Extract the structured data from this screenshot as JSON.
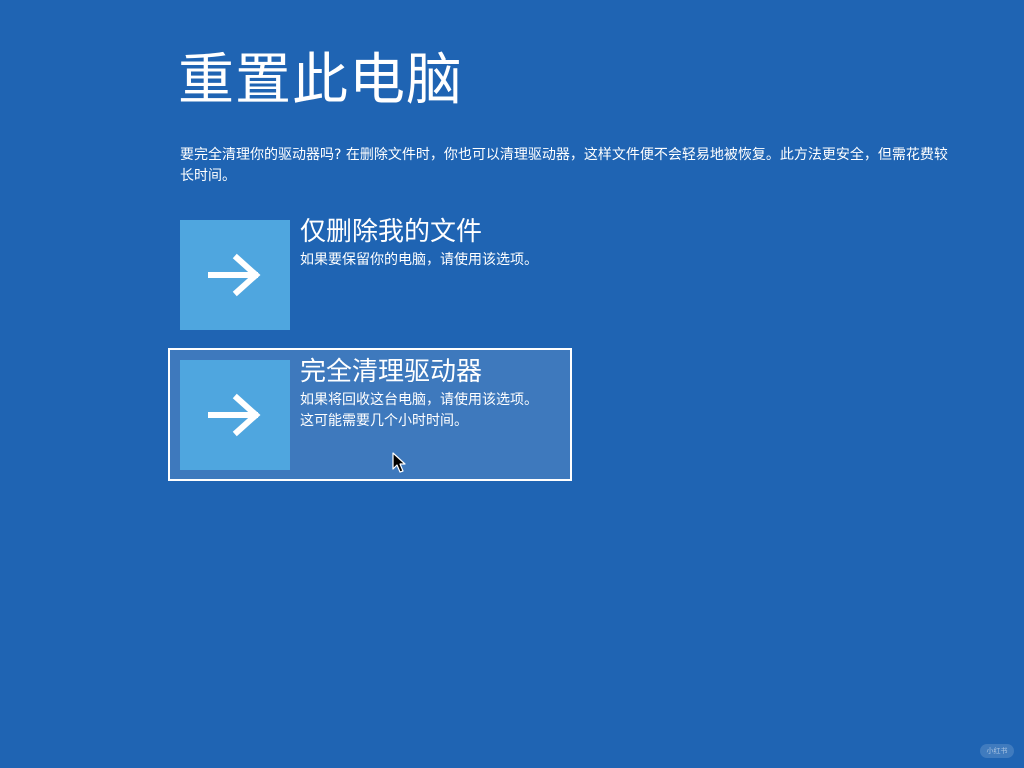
{
  "page": {
    "title": "重置此电脑",
    "description": "要完全清理你的驱动器吗? 在删除文件时，你也可以清理驱动器，这样文件便不会轻易地被恢复。此方法更安全，但需花费较长时间。"
  },
  "options": [
    {
      "title": "仅删除我的文件",
      "description": "如果要保留你的电脑，请使用该选项。",
      "icon": "arrow-right-icon",
      "selected": false
    },
    {
      "title": "完全清理驱动器",
      "description": "如果将回收这台电脑，请使用该选项。这可能需要几个小时时间。",
      "icon": "arrow-right-icon",
      "selected": true
    }
  ],
  "colors": {
    "background": "#1f64b3",
    "tile": "#4fa6df",
    "text": "#ffffff"
  },
  "watermark": "小红书"
}
